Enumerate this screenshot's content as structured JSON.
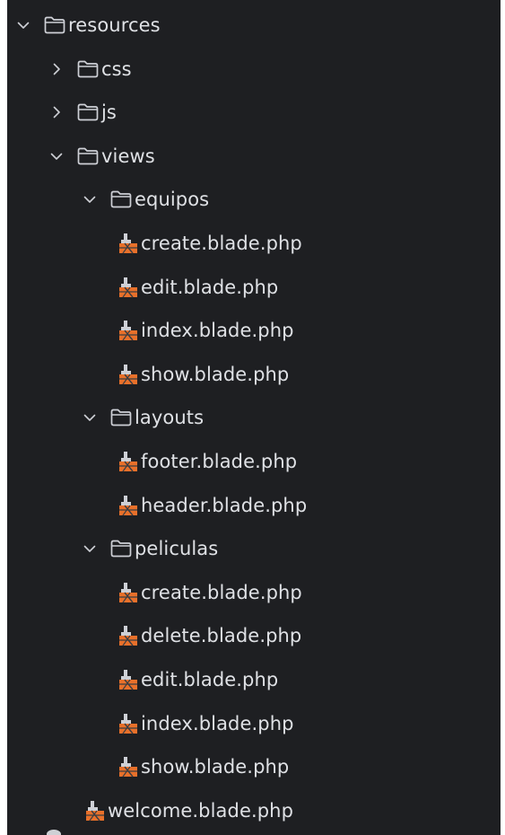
{
  "tree": {
    "items": [
      {
        "label": "resources",
        "type": "folder",
        "state": "expanded",
        "depth": 0,
        "icon": "folder-icon"
      },
      {
        "label": "css",
        "type": "folder",
        "state": "collapsed",
        "depth": 1,
        "icon": "folder-icon"
      },
      {
        "label": "js",
        "type": "folder",
        "state": "collapsed",
        "depth": 1,
        "icon": "folder-icon"
      },
      {
        "label": "views",
        "type": "folder",
        "state": "expanded",
        "depth": 1,
        "icon": "folder-icon"
      },
      {
        "label": "equipos",
        "type": "folder",
        "state": "expanded",
        "depth": 2,
        "icon": "folder-icon"
      },
      {
        "label": "create.blade.php",
        "type": "file",
        "depth": 3,
        "icon": "blade-file-icon"
      },
      {
        "label": "edit.blade.php",
        "type": "file",
        "depth": 3,
        "icon": "blade-file-icon"
      },
      {
        "label": "index.blade.php",
        "type": "file",
        "depth": 3,
        "icon": "blade-file-icon"
      },
      {
        "label": "show.blade.php",
        "type": "file",
        "depth": 3,
        "icon": "blade-file-icon"
      },
      {
        "label": "layouts",
        "type": "folder",
        "state": "expanded",
        "depth": 2,
        "icon": "folder-icon"
      },
      {
        "label": "footer.blade.php",
        "type": "file",
        "depth": 3,
        "icon": "blade-file-icon"
      },
      {
        "label": "header.blade.php",
        "type": "file",
        "depth": 3,
        "icon": "blade-file-icon"
      },
      {
        "label": "peliculas",
        "type": "folder",
        "state": "expanded",
        "depth": 2,
        "icon": "folder-icon"
      },
      {
        "label": "create.blade.php",
        "type": "file",
        "depth": 3,
        "icon": "blade-file-icon"
      },
      {
        "label": "delete.blade.php",
        "type": "file",
        "depth": 3,
        "icon": "blade-file-icon"
      },
      {
        "label": "edit.blade.php",
        "type": "file",
        "depth": 3,
        "icon": "blade-file-icon"
      },
      {
        "label": "index.blade.php",
        "type": "file",
        "depth": 3,
        "icon": "blade-file-icon"
      },
      {
        "label": "show.blade.php",
        "type": "file",
        "depth": 3,
        "icon": "blade-file-icon"
      },
      {
        "label": "welcome.blade.php",
        "type": "file",
        "depth": 2,
        "icon": "blade-file-icon"
      }
    ]
  },
  "colors": {
    "background": "#1e1f22",
    "text": "#dfe1e5",
    "icon_stroke": "#ced0d6",
    "blade_orange": "#e8702a",
    "blade_dark": "#3a3d42"
  }
}
